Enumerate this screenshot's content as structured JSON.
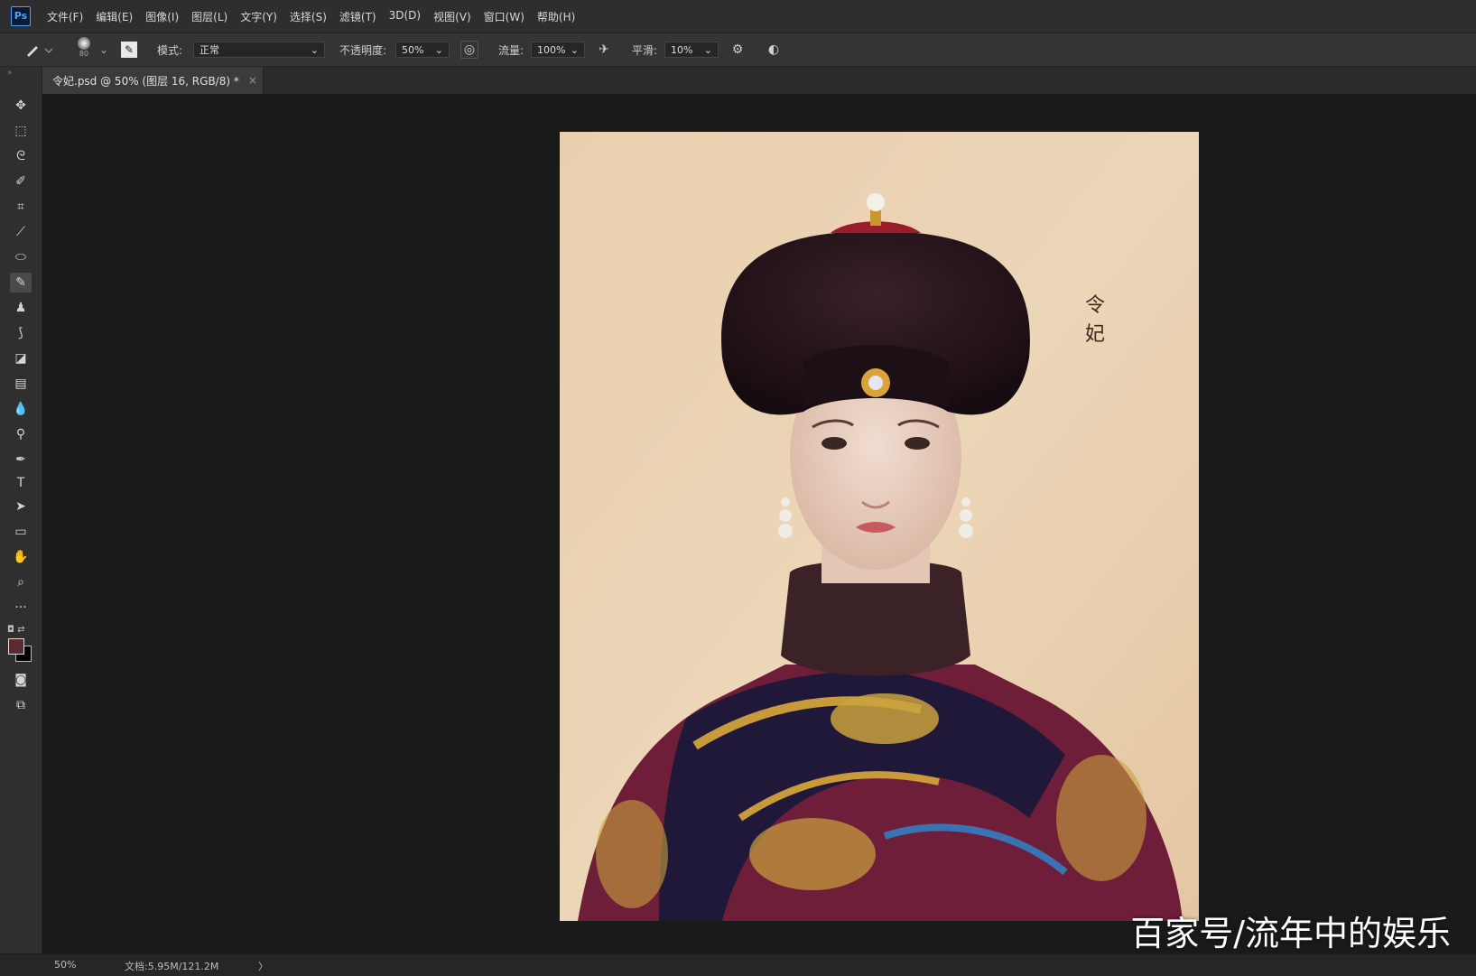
{
  "app": {
    "logo": "Ps"
  },
  "menu": [
    "文件(F)",
    "编辑(E)",
    "图像(I)",
    "图层(L)",
    "文字(Y)",
    "选择(S)",
    "滤镜(T)",
    "3D(D)",
    "视图(V)",
    "窗口(W)",
    "帮助(H)"
  ],
  "options": {
    "brush_size": "80",
    "mode_label": "模式:",
    "mode_value": "正常",
    "opacity_label": "不透明度:",
    "opacity_value": "50%",
    "flow_label": "流量:",
    "flow_value": "100%",
    "smoothing_label": "平滑:",
    "smoothing_value": "10%"
  },
  "document_tab": {
    "title": "令妃.psd @ 50% (图层 16, RGB/8) *",
    "close": "×"
  },
  "status": {
    "zoom": "50%",
    "doc": "文档:5.95M/121.2M",
    "arrow": "〉"
  },
  "painting": {
    "caption_line1": "令",
    "caption_line2": "妃"
  },
  "watermark": "百家号/流年中的娱乐",
  "colors": {
    "foreground": "#5a2a30",
    "background": "#000000"
  },
  "tools": [
    "move-icon",
    "marquee-icon",
    "lasso-icon",
    "quick-select-icon",
    "crop-icon",
    "eyedropper-icon",
    "healing-icon",
    "brush-icon",
    "stamp-icon",
    "history-brush-icon",
    "eraser-icon",
    "gradient-icon",
    "blur-icon",
    "dodge-icon",
    "pen-icon",
    "type-icon",
    "path-select-icon",
    "shape-icon",
    "hand-icon",
    "zoom-icon",
    "more-icon"
  ]
}
